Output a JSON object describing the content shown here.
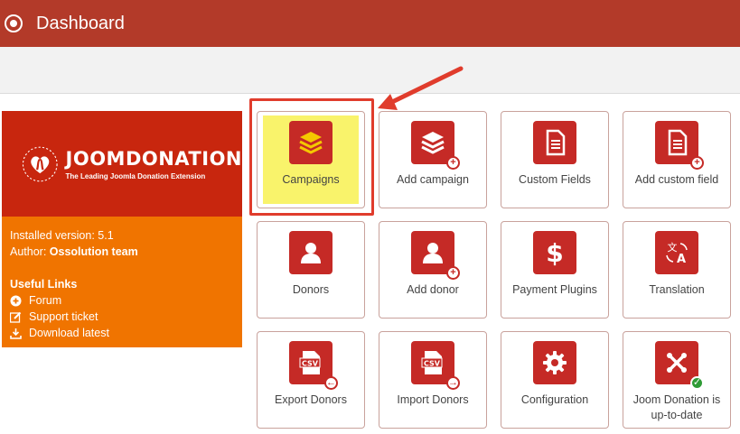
{
  "header": {
    "title": "Dashboard"
  },
  "sidebar": {
    "logo_name": "JOOMDONATION",
    "logo_tagline": "The Leading Joomla Donation Extension",
    "installed_label": "Installed version:",
    "installed_version": "5.1",
    "author_label": "Author:",
    "author_name": "Ossolution team",
    "useful_links_title": "Useful Links",
    "links": [
      {
        "label": "Forum",
        "icon": "plus-circle-icon"
      },
      {
        "label": "Support ticket",
        "icon": "edit-icon"
      },
      {
        "label": "Download latest",
        "icon": "download-icon"
      }
    ]
  },
  "tiles": [
    {
      "label": "Campaigns",
      "icon": "layers-icon"
    },
    {
      "label": "Add campaign",
      "icon": "layers-add-icon"
    },
    {
      "label": "Custom Fields",
      "icon": "document-icon"
    },
    {
      "label": "Add custom field",
      "icon": "document-add-icon"
    },
    {
      "label": "Donors",
      "icon": "user-icon"
    },
    {
      "label": "Add donor",
      "icon": "user-add-icon"
    },
    {
      "label": "Payment Plugins",
      "icon": "dollar-icon"
    },
    {
      "label": "Translation",
      "icon": "translate-icon"
    },
    {
      "label": "Export Donors",
      "icon": "csv-export-icon",
      "badge_text": "CSV"
    },
    {
      "label": "Import Donors",
      "icon": "csv-import-icon",
      "badge_text": "CSV"
    },
    {
      "label": "Configuration",
      "icon": "gear-icon"
    },
    {
      "label": "Joom Donation is up-to-date",
      "icon": "joomla-check-icon"
    }
  ],
  "colors": {
    "header": "#b33a29",
    "logo_bg": "#c8260e",
    "info_bg": "#f07400",
    "tile_icon": "#c52a26",
    "highlight": "#f9f36b",
    "annotation": "#e03c2c"
  }
}
